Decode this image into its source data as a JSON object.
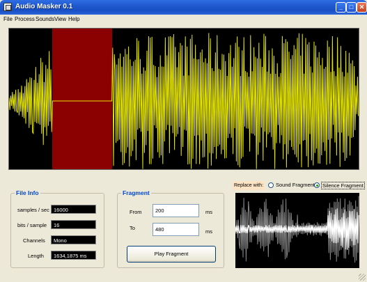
{
  "window": {
    "title": "Audio Masker 0.1",
    "minimize": "_",
    "maximize": "□",
    "close": "✕"
  },
  "menu": [
    "File",
    "Process",
    "Sounds",
    "View",
    "Help"
  ],
  "colors": {
    "wave": "#e6e600",
    "selection": "#8b0000",
    "preview_sound": "#888888",
    "preview_silence": "#ffffff"
  },
  "waveform": {
    "selection_range_ms": [
      200,
      480
    ]
  },
  "file_info": {
    "title": "File Info",
    "fields": [
      {
        "label": "samples / sec",
        "value": "16000"
      },
      {
        "label": "bits / sample",
        "value": "16"
      },
      {
        "label": "Channels",
        "value": "Mono"
      },
      {
        "label": "Length",
        "value": "1634,1875 ms"
      }
    ]
  },
  "fragment": {
    "title": "Fragment",
    "from_label": "From",
    "from_value": "200",
    "from_unit": "ms",
    "to_label": "To",
    "to_value": "480",
    "to_unit": "ms",
    "play_button": "Play Fragment"
  },
  "replace": {
    "label": "Replace with:",
    "options": [
      {
        "label": "Sound Fragment",
        "selected": false
      },
      {
        "label": "Silence Fragment",
        "selected": true
      }
    ]
  }
}
